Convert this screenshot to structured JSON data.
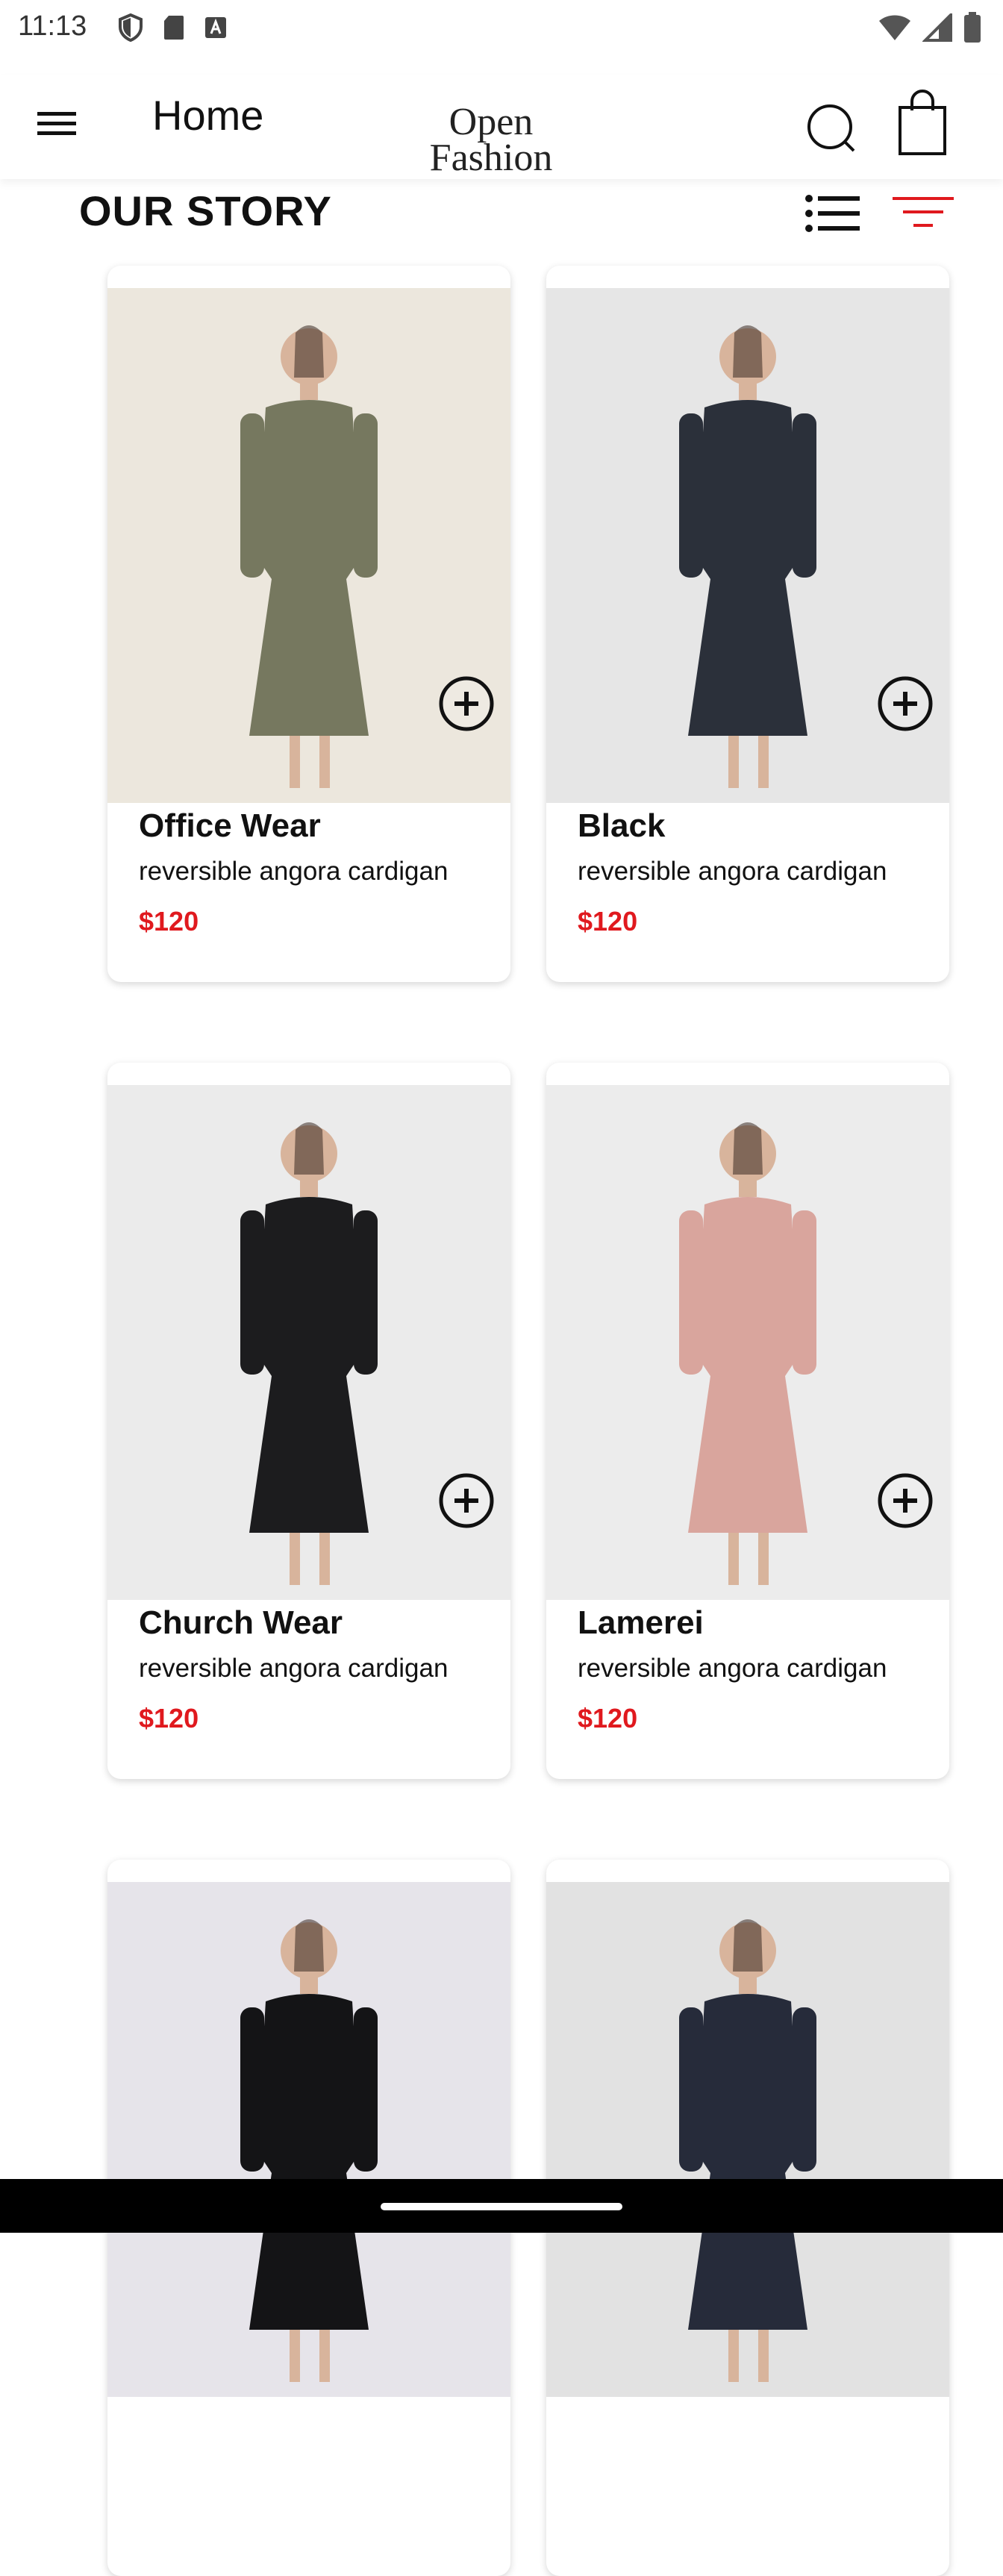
{
  "status_bar": {
    "time": "11:13",
    "left_icons": [
      "shield-icon",
      "sd-card-icon",
      "a-box-icon"
    ],
    "right_icons": [
      "wifi-icon",
      "signal-icon",
      "battery-icon"
    ]
  },
  "app_bar": {
    "title": "Home",
    "logo": {
      "line1": "Open",
      "line2": "Fashion"
    },
    "icons": [
      "menu-icon",
      "search-icon",
      "shopping-bag-icon"
    ]
  },
  "section": {
    "title": "OUR STORY",
    "icons": [
      "list-view-icon",
      "filter-icon"
    ],
    "accent_color": "#e0191e"
  },
  "products": [
    {
      "name": "Office Wear",
      "description": "reversible angora cardigan",
      "price": "$120",
      "dress_color": "#76785f",
      "bg_color": "#ece7dd"
    },
    {
      "name": "Black",
      "description": "reversible angora cardigan",
      "price": "$120",
      "dress_color": "#2b303a",
      "bg_color": "#e6e6e6"
    },
    {
      "name": "Church Wear",
      "description": "reversible angora cardigan",
      "price": "$120",
      "dress_color": "#1c1c1e",
      "bg_color": "#ebebeb"
    },
    {
      "name": "Lamerei",
      "description": "reversible angora cardigan",
      "price": "$120",
      "dress_color": "#d9a59d",
      "bg_color": "#ececec"
    },
    {
      "name": "",
      "description": "",
      "price": "",
      "dress_color": "#141416",
      "bg_color": "#e6e4ea"
    },
    {
      "name": "",
      "description": "",
      "price": "",
      "dress_color": "#262b3a",
      "bg_color": "#e2e2e2"
    }
  ]
}
